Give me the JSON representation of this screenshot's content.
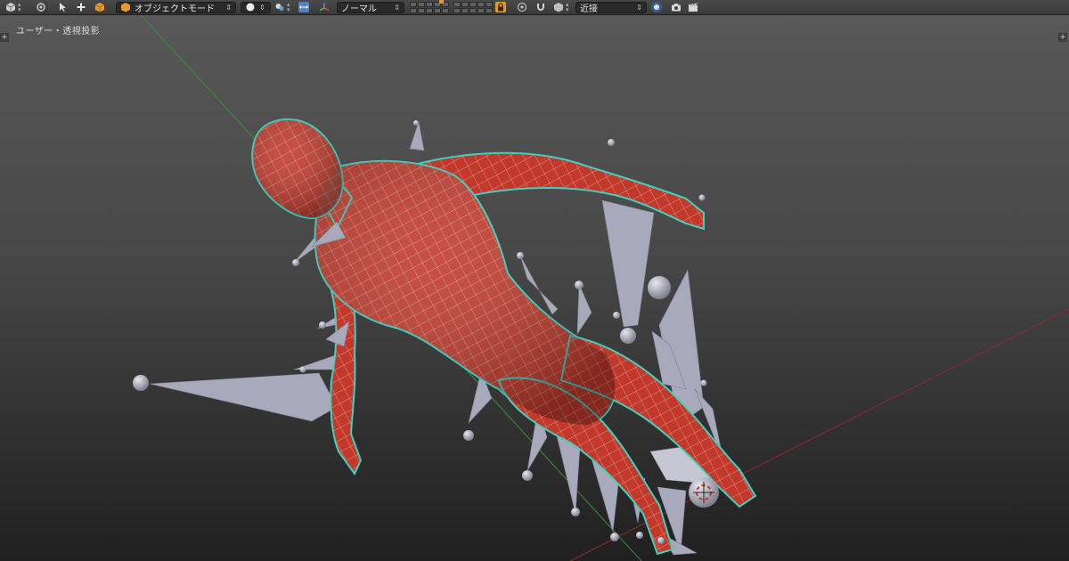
{
  "header": {
    "mode_label": "オブジェクトモード",
    "orientation_label": "ノーマル",
    "snap_label": "近接"
  },
  "viewport": {
    "view_label": "ユーザー・透視投影",
    "axis_x_color": "#8a2b2b",
    "axis_y_color": "#3f8c3f",
    "mesh_color": "#c2392b",
    "wire_color": "#3fd0c0",
    "bone_color": "#a8a9bb"
  },
  "icons": {
    "editor_type": "cube-icon",
    "view_menu": "view-icon",
    "select": "cursor-icon",
    "add": "plus-icon",
    "object": "orange-cube-icon",
    "shading": "solid-sphere-icon",
    "pivot": "pivot-icon",
    "manipulator": "manipulator-icon",
    "proportional": "proportional-icon",
    "snap": "magnet-icon",
    "render": "camera-icon"
  }
}
